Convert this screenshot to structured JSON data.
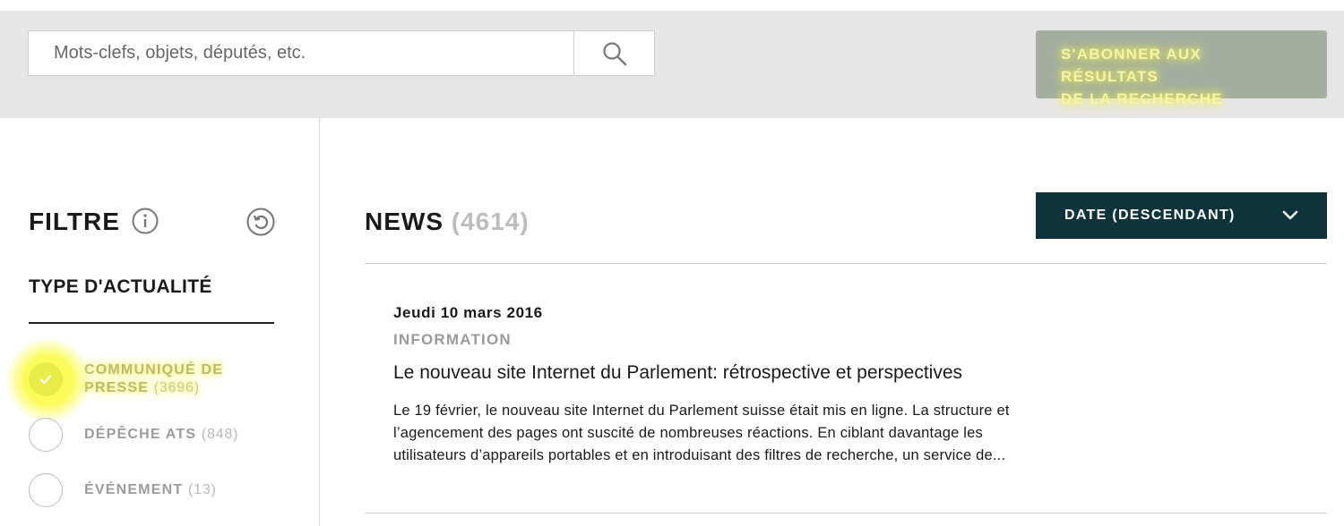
{
  "search": {
    "placeholder": "Mots-clefs, objets, députés, etc.",
    "icon": "search-icon"
  },
  "subscribe": {
    "line1": "S'ABONNER AUX RÉSULTATS",
    "line2": "DE LA RECHERCHE"
  },
  "sidebar": {
    "title": "FILTRE",
    "info_icon": "info-icon",
    "reset_icon": "reset-icon",
    "section_title": "TYPE D'ACTUALITÉ",
    "filters": [
      {
        "line1": "COMMUNIQUÉ DE",
        "line2": "PRESSE",
        "count": "(3696)",
        "checked": true
      },
      {
        "line1": "DÉPÊCHE ATS",
        "count": "(848)",
        "checked": false
      },
      {
        "line1": "ÉVÉNEMENT",
        "count": "(13)",
        "checked": false
      }
    ]
  },
  "main": {
    "title": "NEWS",
    "count": "(4614)",
    "sort_label": "DATE (DESCENDANT)",
    "articles": [
      {
        "date": "Jeudi 10 mars 2016",
        "type": "INFORMATION",
        "title": "Le nouveau site Internet du Parlement: rétrospective et perspectives",
        "excerpt_lines": [
          "Le 19 février, le nouveau site Internet du Parlement suisse était mis en ligne. La structure et",
          "l’agencement des pages ont suscité de nombreuses réactions. En ciblant davantage les",
          "utilisateurs d’appareils portables et en introduisant des filtres de recherche, un service de..."
        ]
      }
    ]
  },
  "colors": {
    "topband": "#e6e6e6",
    "subscribe_bg": "#a3aea0",
    "sort_bg": "#0e333a",
    "checked": "#889584",
    "highlight": "#f2f25a"
  }
}
